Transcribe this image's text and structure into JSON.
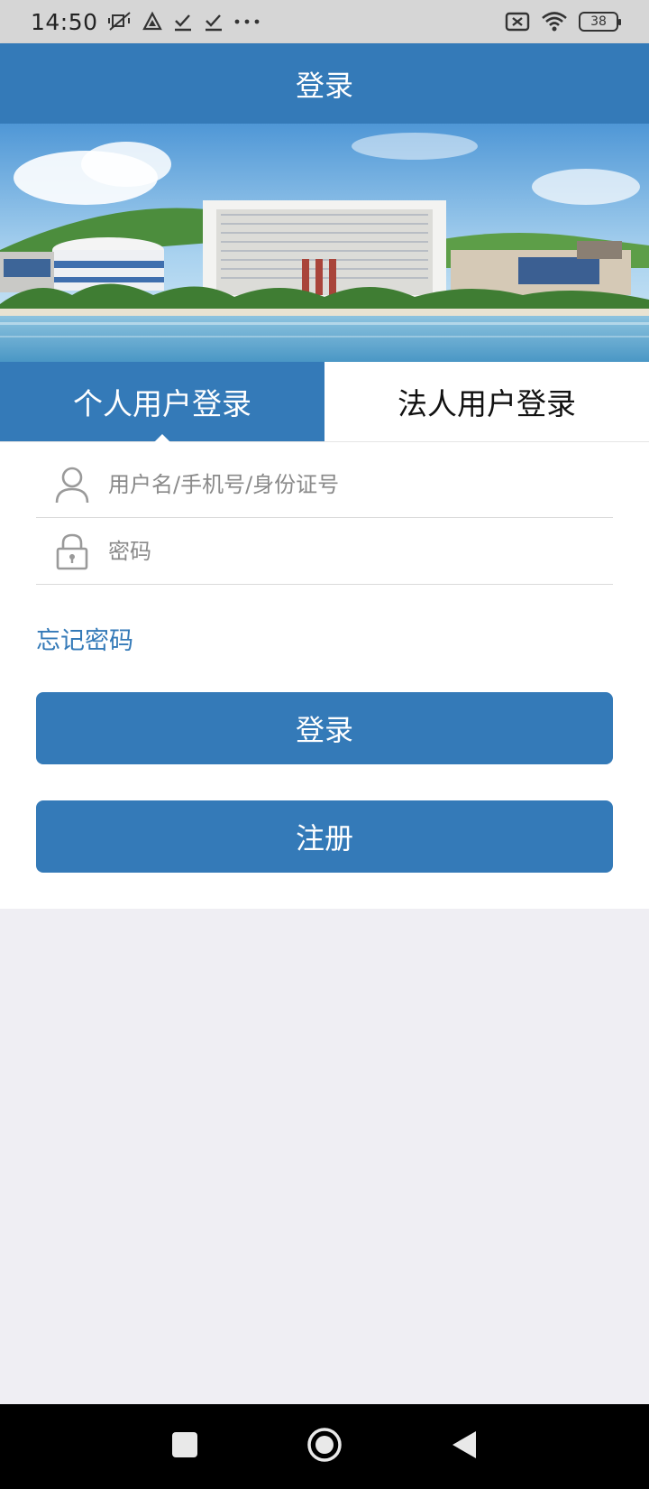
{
  "status_bar": {
    "time": "14:50",
    "battery": "38",
    "icons": [
      "mute-vibrate-icon",
      "navigation-icon",
      "download-done-icon",
      "download-done-icon",
      "more-dots-icon",
      "no-sim-icon",
      "wifi-icon",
      "battery-icon"
    ]
  },
  "header": {
    "title": "登录"
  },
  "tabs": [
    {
      "label": "个人用户登录",
      "active": true
    },
    {
      "label": "法人用户登录",
      "active": false
    }
  ],
  "form": {
    "username_placeholder": "用户名/手机号/身份证号",
    "username_value": "",
    "password_placeholder": "密码",
    "password_value": "",
    "forgot_label": "忘记密码",
    "login_label": "登录",
    "register_label": "注册"
  },
  "colors": {
    "primary": "#347ab8",
    "page_background": "#efeef3",
    "status_bar": "#d6d6d6"
  }
}
